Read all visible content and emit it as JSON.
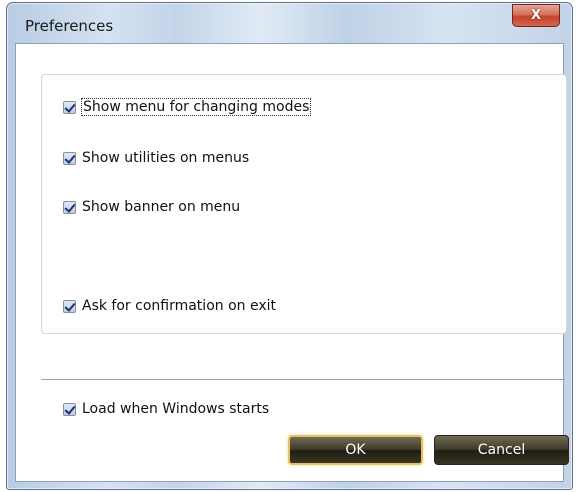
{
  "window": {
    "title": "Preferences",
    "close_glyph": "X"
  },
  "options": [
    {
      "label": "Show menu for changing modes",
      "checked": true,
      "focused": true
    },
    {
      "label": "Show utilities on menus",
      "checked": true
    },
    {
      "label": "Show banner on menu",
      "checked": true
    },
    {
      "label": "Ask for confirmation on exit",
      "checked": true
    }
  ],
  "startup": {
    "label": "Load when Windows starts",
    "checked": true
  },
  "buttons": {
    "ok": "OK",
    "cancel": "Cancel"
  },
  "colors": {
    "button_bg": "#2f2a1c",
    "ok_border": "#e6c16a",
    "close_bg": "#c4442c"
  }
}
